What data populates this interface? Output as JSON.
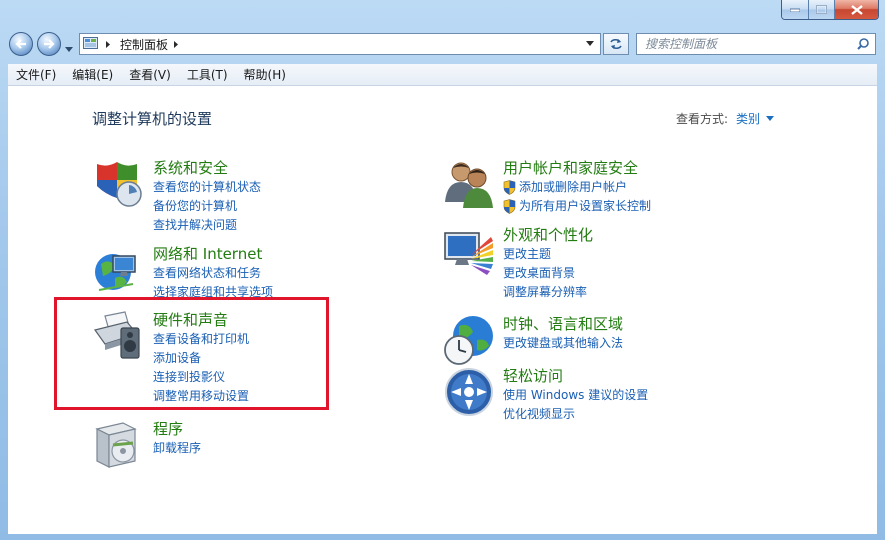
{
  "window": {
    "buttons": [
      "minimize",
      "maximize",
      "close"
    ]
  },
  "address": {
    "path": "控制面板",
    "search_placeholder": "搜索控制面板"
  },
  "menu": [
    "文件(F)",
    "编辑(E)",
    "查看(V)",
    "工具(T)",
    "帮助(H)"
  ],
  "page": {
    "title": "调整计算机的设置",
    "view_by_label": "查看方式:",
    "view_by_value": "类别"
  },
  "categories": {
    "system_security": {
      "title": "系统和安全",
      "links": [
        "查看您的计算机状态",
        "备份您的计算机",
        "查找并解决问题"
      ]
    },
    "network": {
      "title": "网络和 Internet",
      "links": [
        "查看网络状态和任务",
        "选择家庭组和共享选项"
      ]
    },
    "hardware": {
      "title": "硬件和声音",
      "links": [
        "查看设备和打印机",
        "添加设备",
        "连接到投影仪",
        "调整常用移动设置"
      ]
    },
    "programs": {
      "title": "程序",
      "links": [
        "卸载程序"
      ]
    },
    "user_accounts": {
      "title": "用户帐户和家庭安全",
      "links": [
        "添加或删除用户帐户",
        "为所有用户设置家长控制"
      ]
    },
    "appearance": {
      "title": "外观和个性化",
      "links": [
        "更改主题",
        "更改桌面背景",
        "调整屏幕分辨率"
      ]
    },
    "clock": {
      "title": "时钟、语言和区域",
      "links": [
        "更改键盘或其他输入法"
      ]
    },
    "ease": {
      "title": "轻松访问",
      "links": [
        "使用 Windows 建议的设置",
        "优化视频显示"
      ]
    }
  },
  "colors": {
    "category_title": "#237c11",
    "link": "#1a5fb4",
    "highlight": "#e0142b"
  }
}
